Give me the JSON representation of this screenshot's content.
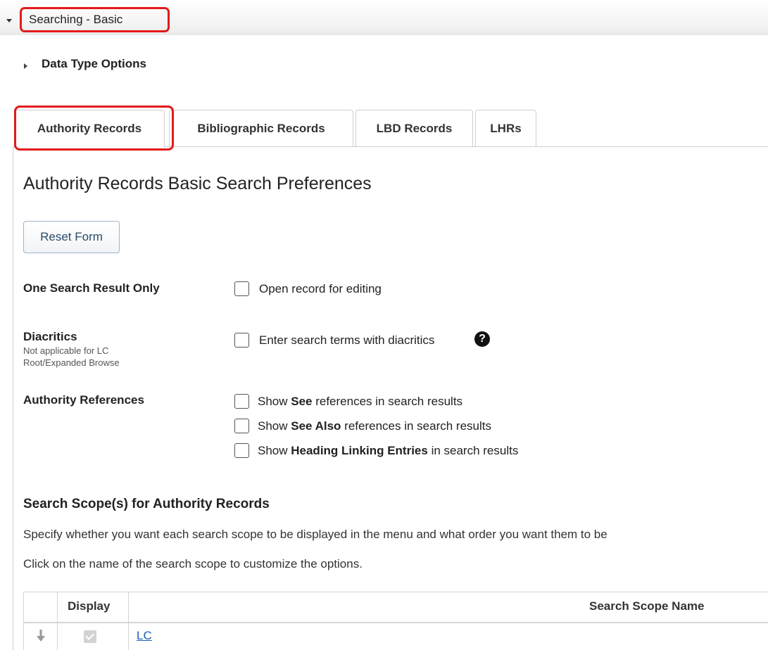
{
  "section": {
    "title": "Searching - Basic"
  },
  "data_type_options": {
    "label": "Data Type Options"
  },
  "tabs": [
    {
      "label": "Authority Records",
      "active": true
    },
    {
      "label": "Bibliographic Records",
      "active": false
    },
    {
      "label": "LBD Records",
      "active": false
    },
    {
      "label": "LHRs",
      "active": false
    }
  ],
  "page_heading": "Authority Records Basic Search Preferences",
  "reset_button": "Reset Form",
  "one_search": {
    "label": "One Search Result Only",
    "option": "Open record for editing"
  },
  "diacritics": {
    "label": "Diacritics",
    "note": "Not applicable for LC Root/Expanded Browse",
    "option": "Enter search terms with diacritics",
    "help_icon": "question-circle-icon"
  },
  "authority_references": {
    "label": "Authority References",
    "options": [
      {
        "pre": "Show ",
        "bold": "See",
        "post": " references in search results"
      },
      {
        "pre": "Show ",
        "bold": "See Also",
        "post": " references in search results"
      },
      {
        "pre": "Show ",
        "bold": "Heading Linking Entries",
        "post": " in search results"
      }
    ]
  },
  "scope": {
    "heading": "Search Scope(s) for Authority Records",
    "para1": "Specify whether you want each search scope to be displayed in the menu and what order you want them to be",
    "para2": "Click on the name of the search scope to customize the options.",
    "columns": {
      "display": "Display",
      "name": "Search Scope Name"
    },
    "rows": [
      {
        "display": true,
        "name": "LC"
      }
    ]
  },
  "colors": {
    "highlight": "#e31a1a",
    "link": "#1a5fb4"
  }
}
